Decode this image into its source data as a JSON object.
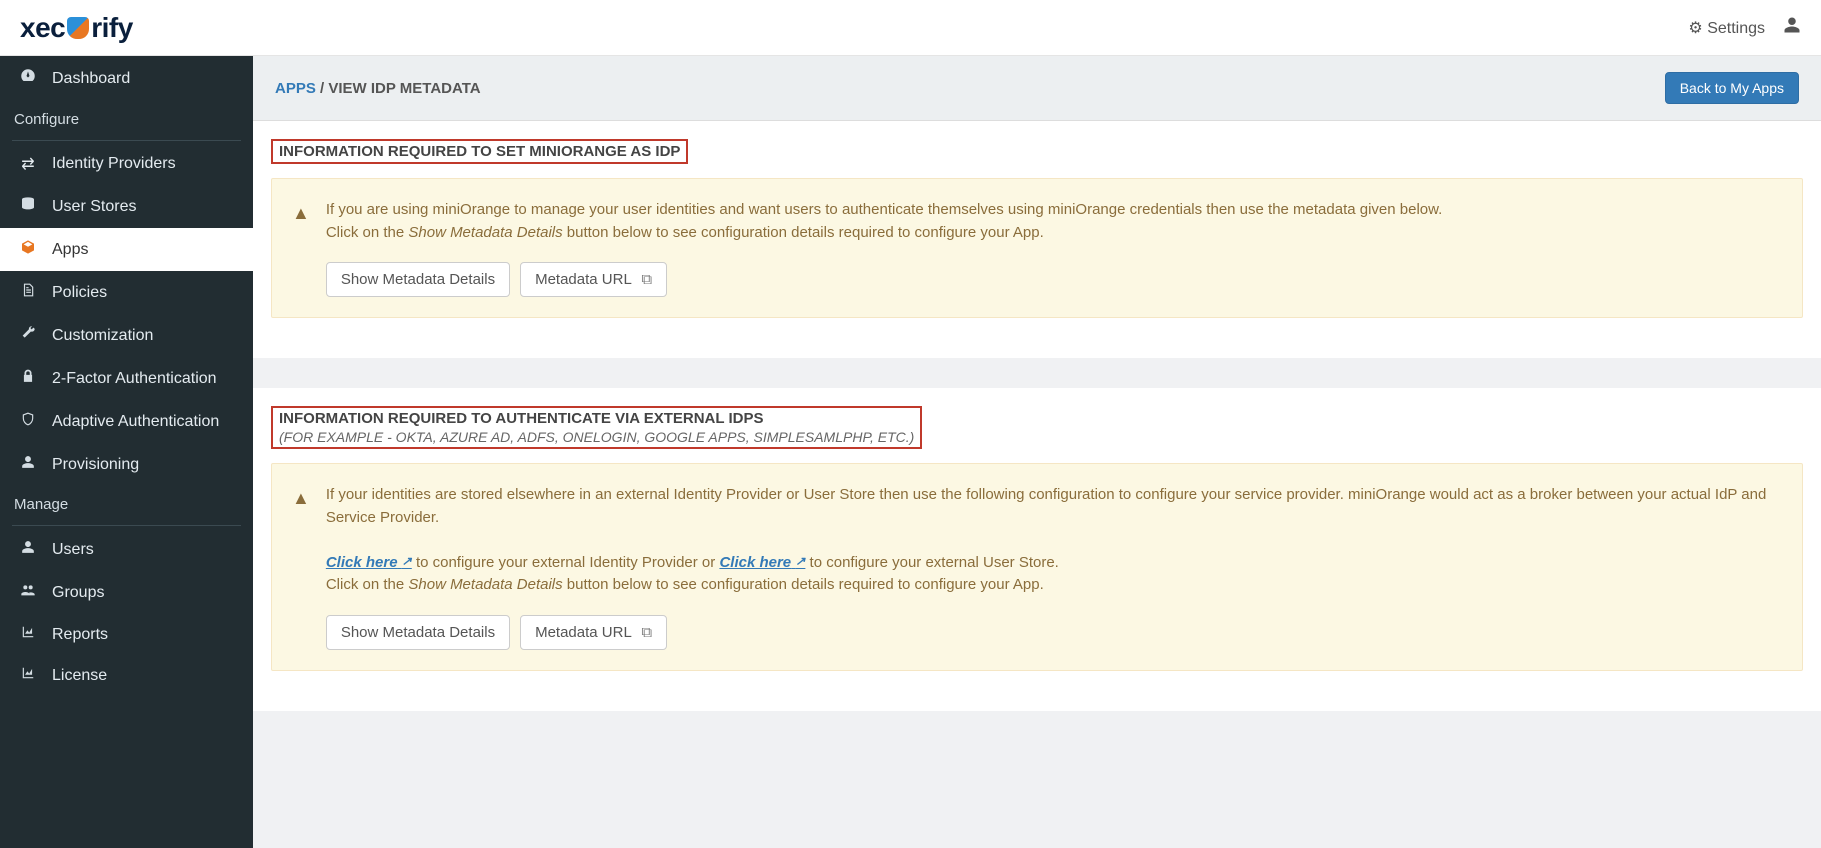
{
  "header": {
    "logo_left": "xec",
    "logo_right": "rify",
    "settings_label": "Settings"
  },
  "sidebar": {
    "items": [
      {
        "label": "Dashboard"
      },
      {
        "label": "Identity Providers"
      },
      {
        "label": "User Stores"
      },
      {
        "label": "Apps"
      },
      {
        "label": "Policies"
      },
      {
        "label": "Customization"
      },
      {
        "label": "2-Factor Authentication"
      },
      {
        "label": "Adaptive Authentication"
      },
      {
        "label": "Provisioning"
      },
      {
        "label": "Users"
      },
      {
        "label": "Groups"
      },
      {
        "label": "Reports"
      },
      {
        "label": "License"
      }
    ],
    "section_configure": "Configure",
    "section_manage": "Manage"
  },
  "breadcrumb": {
    "root": "APPS",
    "sep": " / ",
    "current": "VIEW IDP METADATA",
    "back_button": "Back to My Apps"
  },
  "section1": {
    "title": "INFORMATION REQUIRED TO SET MINIORANGE AS IDP",
    "alert_line1": "If you are using miniOrange to manage your user identities and want users to authenticate themselves using miniOrange credentials then use the metadata given below.",
    "alert_line2_pre": "Click on the ",
    "alert_line2_em": "Show Metadata Details",
    "alert_line2_post": " button below to see configuration details required to configure your App.",
    "btn_show": "Show Metadata Details",
    "btn_url": "Metadata URL"
  },
  "section2": {
    "title": "INFORMATION REQUIRED TO AUTHENTICATE VIA EXTERNAL IDPS",
    "subtitle": "(FOR EXAMPLE - OKTA, AZURE AD, ADFS, ONELOGIN, GOOGLE APPS, SIMPLESAMLPHP, ETC.)",
    "alert_p1": "If your identities are stored elsewhere in an external Identity Provider or User Store then use the following configuration to configure your service provider. miniOrange would act as a broker between your actual IdP and Service Provider.",
    "link1": "Click here",
    "after_link1": " to configure your external Identity Provider or ",
    "link2": "Click here",
    "after_link2": " to configure your external User Store.",
    "p3_pre": "Click on the ",
    "p3_em": "Show Metadata Details",
    "p3_post": " button below to see configuration details required to configure your App.",
    "btn_show": "Show Metadata Details",
    "btn_url": "Metadata URL"
  }
}
